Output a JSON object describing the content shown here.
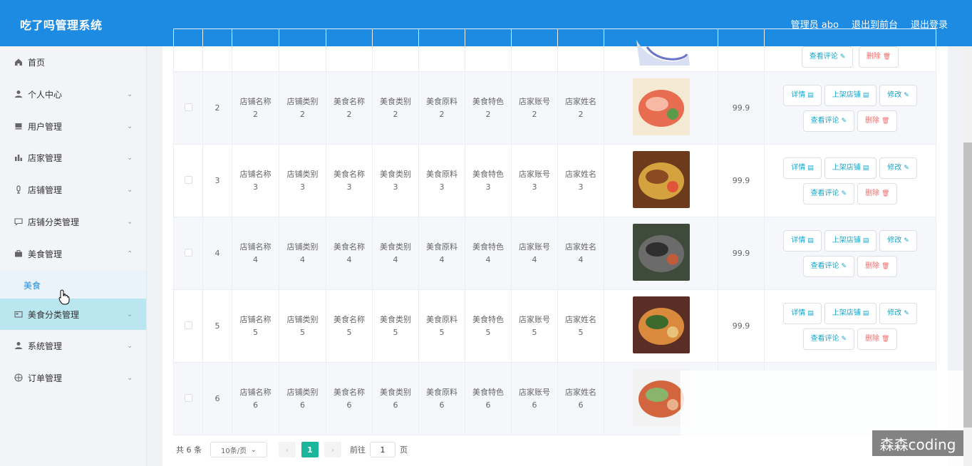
{
  "header": {
    "title": "吃了吗管理系统",
    "admin_label": "管理员 abo",
    "back_frontend": "退出到前台",
    "logout": "退出登录"
  },
  "sidebar": {
    "items": [
      {
        "label": "首页",
        "icon": "home-icon"
      },
      {
        "label": "个人中心",
        "icon": "user-icon"
      },
      {
        "label": "用户管理",
        "icon": "users-icon"
      },
      {
        "label": "店家管理",
        "icon": "chart-icon"
      },
      {
        "label": "店铺管理",
        "icon": "mic-icon"
      },
      {
        "label": "店铺分类管理",
        "icon": "message-icon"
      },
      {
        "label": "美食管理",
        "icon": "briefcase-icon"
      },
      {
        "label": "美食分类管理",
        "icon": "card-icon"
      },
      {
        "label": "系统管理",
        "icon": "user-icon"
      },
      {
        "label": "订单管理",
        "icon": "globe-icon"
      }
    ],
    "sub_item": "美食"
  },
  "table": {
    "rows": [
      {
        "id": "2",
        "shop_name": "店铺名称",
        "shop_type": "店铺类别",
        "food_name": "美食名称",
        "food_type": "美食类别",
        "ingredients": "美食原料",
        "feature": "美食特色",
        "account": "店家账号",
        "owner": "店家姓名",
        "n": "2",
        "price": "99.9"
      },
      {
        "id": "3",
        "shop_name": "店铺名称",
        "shop_type": "店铺类别",
        "food_name": "美食名称",
        "food_type": "美食类别",
        "ingredients": "美食原料",
        "feature": "美食特色",
        "account": "店家账号",
        "owner": "店家姓名",
        "n": "3",
        "price": "99.9"
      },
      {
        "id": "4",
        "shop_name": "店铺名称",
        "shop_type": "店铺类别",
        "food_name": "美食名称",
        "food_type": "美食类别",
        "ingredients": "美食原料",
        "feature": "美食特色",
        "account": "店家账号",
        "owner": "店家姓名",
        "n": "4",
        "price": "99.9"
      },
      {
        "id": "5",
        "shop_name": "店铺名称",
        "shop_type": "店铺类别",
        "food_name": "美食名称",
        "food_type": "美食类别",
        "ingredients": "美食原料",
        "feature": "美食特色",
        "account": "店家账号",
        "owner": "店家姓名",
        "n": "5",
        "price": "99.9"
      },
      {
        "id": "6",
        "shop_name": "店铺名称",
        "shop_type": "店铺类别",
        "food_name": "美食名称",
        "food_type": "美食类别",
        "ingredients": "美食原料",
        "feature": "美食特色",
        "account": "店家账号",
        "owner": "店家姓名",
        "n": "6",
        "price": ""
      }
    ],
    "buttons": {
      "detail": "详情",
      "list_shop": "上架店铺",
      "edit": "修改",
      "view_comments": "查看评论",
      "delete": "删除"
    },
    "top_buttons": {
      "view_comments": "查看评论",
      "delete": "删除"
    }
  },
  "pagination": {
    "total": "共 6 条",
    "page_size": "10条/页",
    "current_page": "1",
    "goto_label": "前往",
    "goto_value": "1",
    "page_unit": "页"
  },
  "watermark": "森森coding",
  "colors": {
    "header": "#1e8be3",
    "active_menu": "#b9e6ef",
    "active_page": "#1bb59c",
    "delete": "#f56c6c",
    "link": "#1ba5c9"
  }
}
